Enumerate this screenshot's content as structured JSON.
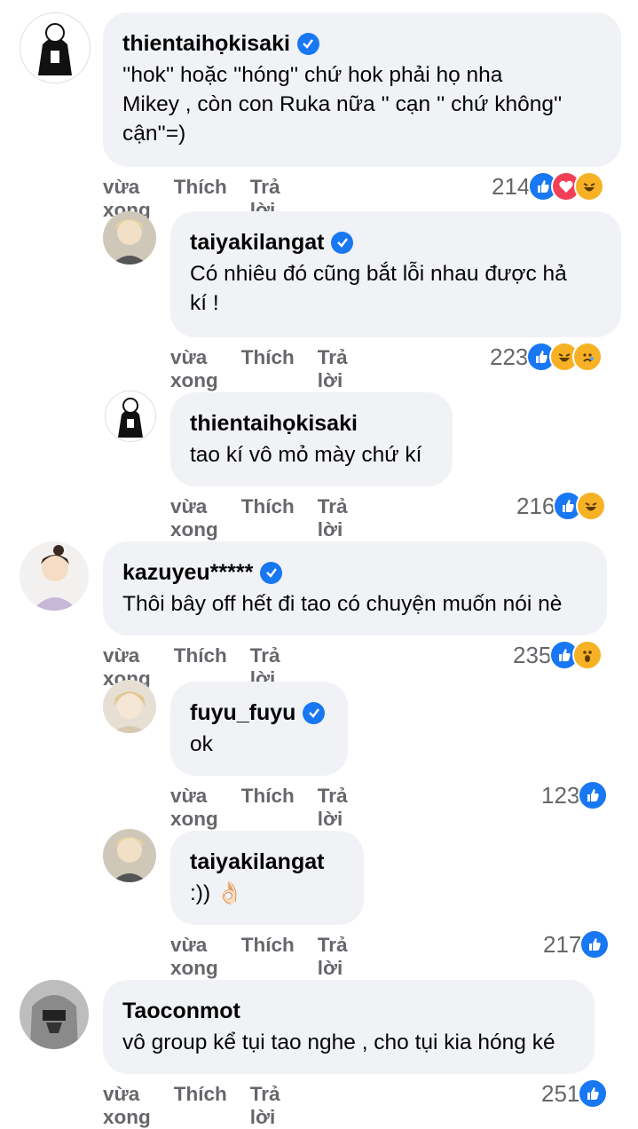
{
  "comments": [
    {
      "name": "thientaihọkisaki",
      "verified": true,
      "text": "''hok'' hoặc ''hóng'' chứ hok phải họ nha\nMikey , còn con Ruka nữa '' cạn '' chứ không''\ncận''=)",
      "time": "vừa xong",
      "like": "Thích",
      "reply": "Trả lời",
      "count": "214",
      "reactions": [
        "like-icon",
        "love-icon",
        "haha-icon"
      ]
    },
    {
      "name": "taiyakilangat",
      "verified": true,
      "text": "Có nhiêu đó cũng bắt lỗi nhau được hả\nkí !",
      "time": "vừa xong",
      "like": "Thích",
      "reply": "Trả lời",
      "count": "223",
      "reactions": [
        "like-icon",
        "haha-icon",
        "sad-icon"
      ]
    },
    {
      "name": "thientaihọkisaki",
      "verified": false,
      "text": "tao kí vô mỏ mày chứ kí",
      "time": "vừa xong",
      "like": "Thích",
      "reply": "Trả lời",
      "count": "216",
      "reactions": [
        "like-icon",
        "haha-icon"
      ]
    },
    {
      "name": "kazuyeu*****",
      "verified": true,
      "text": "Thôi bây off hết đi tao có chuyện muốn nói nè",
      "time": "vừa xong",
      "like": "Thích",
      "reply": "Trả lời",
      "count": "235",
      "reactions": [
        "like-icon",
        "wow-icon"
      ]
    },
    {
      "name": "fuyu_fuyu",
      "verified": true,
      "text": "ok",
      "time": "vừa xong",
      "like": "Thích",
      "reply": "Trả lời",
      "count": "123",
      "reactions": [
        "like-icon"
      ]
    },
    {
      "name": "taiyakilangat",
      "verified": false,
      "text": ":)) 👌🏻",
      "time": "vừa xong",
      "like": "Thích",
      "reply": "Trả lời",
      "count": "217",
      "reactions": [
        "like-icon"
      ]
    },
    {
      "name": "Taoconmot",
      "verified": false,
      "text": "vô group kể tụi tao nghe , cho tụi kia hóng ké",
      "time": "vừa xong",
      "like": "Thích",
      "reply": "Trả lời",
      "count": "251",
      "reactions": [
        "like-icon"
      ]
    }
  ],
  "colors": {
    "bubble": "#f0f2f5",
    "meta": "#65676b",
    "like": "#1877f2",
    "love": "#f33e58",
    "haha": "#f7b125"
  }
}
